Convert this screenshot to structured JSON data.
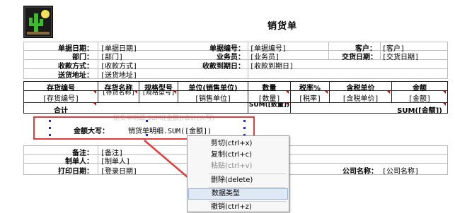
{
  "report": {
    "title": "销货单",
    "header_rows": [
      {
        "label": "单据日期：",
        "value": "[单据日期]"
      },
      {
        "label": "单据编号：",
        "value": "[单据编号]"
      },
      {
        "label": "客户：",
        "value": "[客户]"
      },
      {
        "label": "部门：",
        "value": "[部门]"
      },
      {
        "label": "业务员：",
        "value": "[业务员]"
      },
      {
        "label": "交货日期：",
        "value": "[交货日期]"
      },
      {
        "label": "收款方式：",
        "value": "[收款方式]"
      },
      {
        "label": "收款到期日：",
        "value": "[收款到期日]"
      },
      {
        "label": "送货地址：",
        "value": "[送货地址]"
      }
    ],
    "table": {
      "columns": [
        "存货编号",
        "存货名称",
        "规格型号",
        "单位(销售单位)",
        "数量",
        "税率%",
        "含税单价",
        "金额"
      ],
      "row": [
        "[存货编号]",
        "[存货名称]",
        "[规格型号]",
        "[销售单位]",
        "[数量]",
        "[税率]",
        "[含税单价]",
        "[金额]"
      ],
      "total_label": "合计",
      "sum_qty": "SUM([数量])",
      "sum_amount": "SUM([金额])"
    },
    "ghost_text": "销货单明细.SUM([金额])合计(大写)",
    "amount_label": "金额大写：",
    "amount_value": "销货单明细.SUM([金额])",
    "footer": [
      {
        "label": "备注：",
        "value": "[备注]"
      },
      {
        "label": "制单人：",
        "value": "[制单人]"
      },
      {
        "label": "打印日期：",
        "value": "[登录日期]"
      },
      {
        "label": "公司名称：",
        "value": "[公司名称]"
      }
    ]
  },
  "context_menu": {
    "items": [
      {
        "label": "剪切(ctrl+x)",
        "enabled": true
      },
      {
        "label": "复制(ctrl+c)",
        "enabled": true
      },
      {
        "label": "粘贴(ctrl+v)",
        "enabled": false
      },
      {
        "label": "删除(delete)",
        "enabled": true
      },
      {
        "label": "数据类型",
        "enabled": true,
        "highlighted": true
      },
      {
        "label": "撤销(ctrl+z)",
        "enabled": true
      }
    ]
  },
  "colors": {
    "highlight_box": "#e23c3c",
    "arrow": "#e23c3c",
    "menu_highlight": "#dfe8f5",
    "handles": "#1f2fc8"
  },
  "icons": {
    "logo": "cactus-logo-icon",
    "arrow": "red-arrow-icon"
  }
}
